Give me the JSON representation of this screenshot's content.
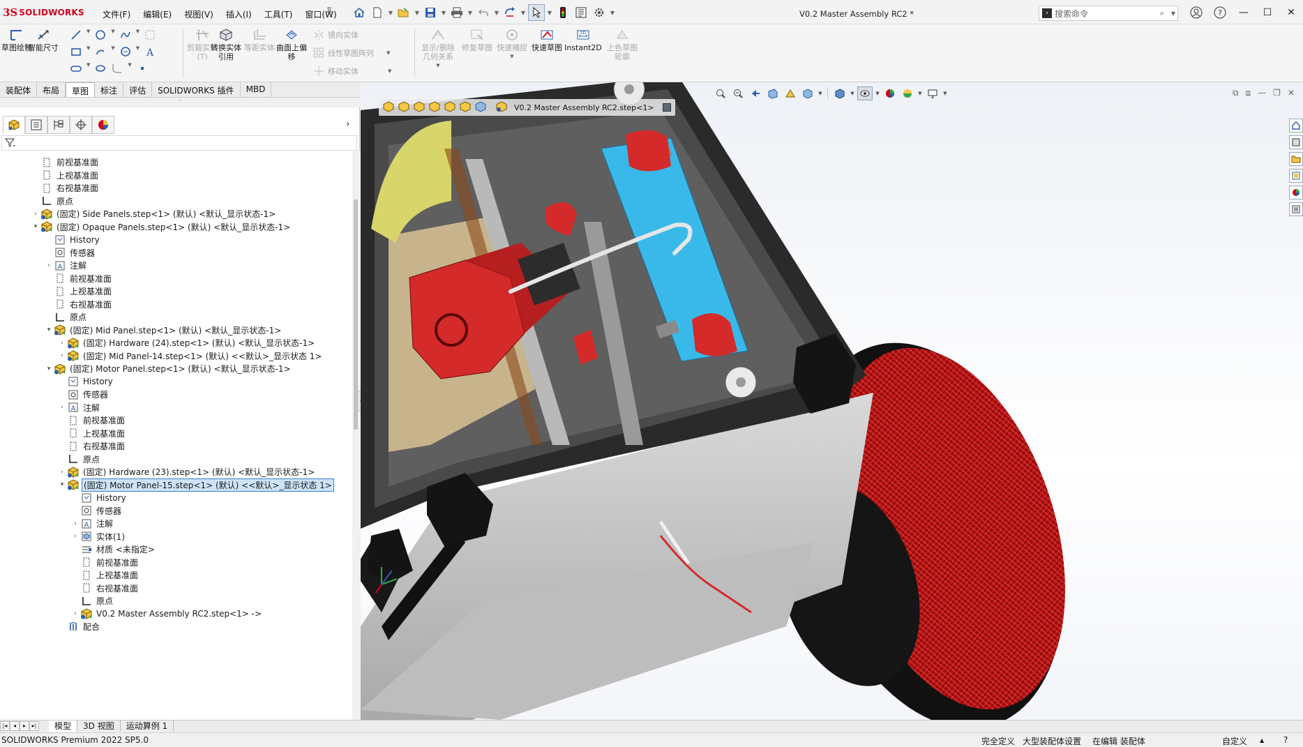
{
  "app": {
    "logo_ds": "3S",
    "logo_name": "SOLIDWORKS",
    "document_title": "V0.2 Master Assembly RC2 *"
  },
  "menu": {
    "items": [
      "文件(F)",
      "编辑(E)",
      "视图(V)",
      "插入(I)",
      "工具(T)",
      "窗口(W)"
    ]
  },
  "search": {
    "placeholder": "搜索命令"
  },
  "command_manager": {
    "sketch": "草图绘制",
    "smart_dim": "智能尺寸",
    "trim": "剪裁实体(T)",
    "convert": "转换实体引用",
    "offset": "等距实体",
    "surface_offset": "曲面上偏移",
    "mirror": "镜向实体",
    "linear_pattern": "线性草图阵列",
    "move": "移动实体",
    "display_delete": "显示/删除几何关系",
    "repair": "修复草图",
    "quick_snap": "快速捕捉",
    "rapid_sketch": "快速草图",
    "instant2d": "Instant2D",
    "shaded_contours": "上色草图轮廓"
  },
  "tabs": {
    "items": [
      "装配体",
      "布局",
      "草图",
      "标注",
      "评估",
      "SOLIDWORKS 插件",
      "MBD"
    ],
    "active_index": 2
  },
  "tree": {
    "rows": [
      {
        "indent": 0,
        "expander": "",
        "icon": "plane-icon",
        "label": "前视基准面"
      },
      {
        "indent": 0,
        "expander": "",
        "icon": "plane-icon",
        "label": "上视基准面"
      },
      {
        "indent": 0,
        "expander": "",
        "icon": "plane-icon",
        "label": "右视基准面"
      },
      {
        "indent": 0,
        "expander": "",
        "icon": "origin-icon",
        "label": "原点"
      },
      {
        "indent": 0,
        "expander": "›",
        "icon": "subassembly-icon",
        "label": "(固定) Side Panels.step<1> (默认) <默认_显示状态-1>"
      },
      {
        "indent": 0,
        "expander": "⌄",
        "icon": "subassembly-icon",
        "label": "(固定) Opaque Panels.step<1> (默认) <默认_显示状态-1>"
      },
      {
        "indent": 1,
        "expander": "",
        "icon": "history-icon",
        "label": "History"
      },
      {
        "indent": 1,
        "expander": "",
        "icon": "sensor-icon",
        "label": "传感器"
      },
      {
        "indent": 1,
        "expander": "›",
        "icon": "annotation-icon",
        "label": "注解"
      },
      {
        "indent": 1,
        "expander": "",
        "icon": "plane-icon",
        "label": "前视基准面"
      },
      {
        "indent": 1,
        "expander": "",
        "icon": "plane-icon",
        "label": "上视基准面"
      },
      {
        "indent": 1,
        "expander": "",
        "icon": "plane-icon",
        "label": "右视基准面"
      },
      {
        "indent": 1,
        "expander": "",
        "icon": "origin-icon",
        "label": "原点"
      },
      {
        "indent": 1,
        "expander": "⌄",
        "icon": "subassembly-icon",
        "label": "(固定) Mid Panel.step<1> (默认) <默认_显示状态-1>"
      },
      {
        "indent": 2,
        "expander": "›",
        "icon": "subassembly-icon",
        "label": "(固定) Hardware (24).step<1> (默认) <默认_显示状态-1>"
      },
      {
        "indent": 2,
        "expander": "›",
        "icon": "subassembly-icon",
        "label": "(固定) Mid Panel-14.step<1> (默认) <<默认>_显示状态 1>"
      },
      {
        "indent": 1,
        "expander": "⌄",
        "icon": "subassembly-icon",
        "label": "(固定) Motor Panel.step<1> (默认) <默认_显示状态-1>"
      },
      {
        "indent": 2,
        "expander": "",
        "icon": "history-icon",
        "label": "History"
      },
      {
        "indent": 2,
        "expander": "",
        "icon": "sensor-icon",
        "label": "传感器"
      },
      {
        "indent": 2,
        "expander": "›",
        "icon": "annotation-icon",
        "label": "注解"
      },
      {
        "indent": 2,
        "expander": "",
        "icon": "plane-icon",
        "label": "前视基准面"
      },
      {
        "indent": 2,
        "expander": "",
        "icon": "plane-icon",
        "label": "上视基准面"
      },
      {
        "indent": 2,
        "expander": "",
        "icon": "plane-icon",
        "label": "右视基准面"
      },
      {
        "indent": 2,
        "expander": "",
        "icon": "origin-icon",
        "label": "原点"
      },
      {
        "indent": 2,
        "expander": "›",
        "icon": "subassembly-icon",
        "label": "(固定) Hardware (23).step<1> (默认) <默认_显示状态-1>"
      },
      {
        "indent": 2,
        "expander": "⌄",
        "icon": "subassembly-icon",
        "label": "(固定) Motor Panel-15.step<1> (默认) <<默认>_显示状态 1>",
        "selected": true
      },
      {
        "indent": 3,
        "expander": "",
        "icon": "history-icon",
        "label": "History"
      },
      {
        "indent": 3,
        "expander": "",
        "icon": "sensor-icon",
        "label": "传感器"
      },
      {
        "indent": 3,
        "expander": "›",
        "icon": "annotation-icon",
        "label": "注解"
      },
      {
        "indent": 3,
        "expander": "›",
        "icon": "solid-bodies-icon",
        "label": "实体(1)"
      },
      {
        "indent": 3,
        "expander": "",
        "icon": "material-icon",
        "label": "材质 <未指定>"
      },
      {
        "indent": 3,
        "expander": "",
        "icon": "plane-icon",
        "label": "前视基准面"
      },
      {
        "indent": 3,
        "expander": "",
        "icon": "plane-icon",
        "label": "上视基准面"
      },
      {
        "indent": 3,
        "expander": "",
        "icon": "plane-icon",
        "label": "右视基准面"
      },
      {
        "indent": 3,
        "expander": "",
        "icon": "origin-icon",
        "label": "原点"
      },
      {
        "indent": 3,
        "expander": "›",
        "icon": "subassembly-icon",
        "label": "V0.2 Master Assembly RC2.step<1> ->"
      },
      {
        "indent": 2,
        "expander": "",
        "icon": "mates-icon",
        "label": "配合"
      }
    ]
  },
  "breadcrumb": {
    "label": "V0.2 Master Assembly RC2.step<1>"
  },
  "bottom_tabs": {
    "items": [
      "模型",
      "3D 视图",
      "运动算例 1"
    ],
    "active_index": 0
  },
  "status": {
    "product": "SOLIDWORKS Premium 2022 SP5.0",
    "defined": "完全定义",
    "large_assembly": "大型装配体设置",
    "editing": "在编辑 装配体",
    "units": "自定义"
  },
  "colors": {
    "brand_red": "#d0021b",
    "selection_blue": "#cde3f7",
    "part_red": "#d42a2a",
    "part_cyan": "#39b9ea",
    "frame_black": "#1b1b1b"
  }
}
